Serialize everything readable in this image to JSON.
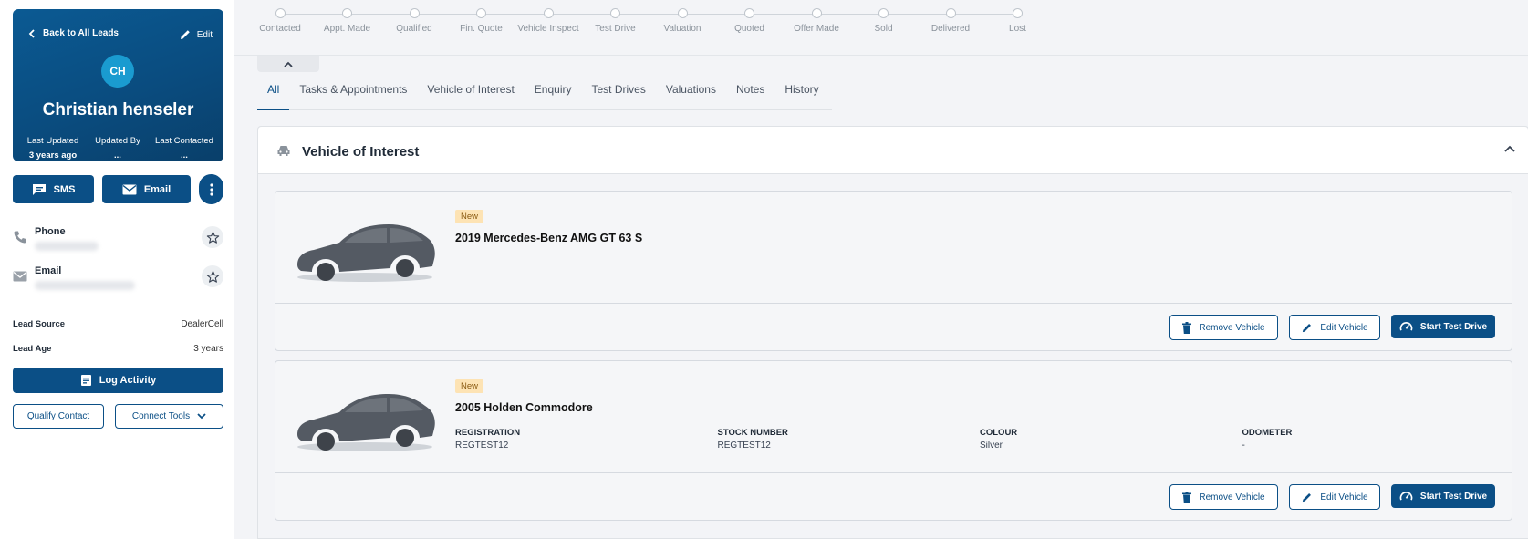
{
  "lead": {
    "back_label": "Back to All Leads",
    "edit_label": "Edit",
    "initials": "CH",
    "name": "Christian henseler",
    "meta": [
      {
        "label": "Last Updated",
        "value": "3 years ago"
      },
      {
        "label": "Updated By",
        "value": "..."
      },
      {
        "label": "Last Contacted",
        "value": "..."
      }
    ]
  },
  "actions": {
    "sms_label": "SMS",
    "email_label": "Email"
  },
  "contacts": {
    "phone_label": "Phone",
    "email_label": "Email"
  },
  "details": {
    "lead_source_label": "Lead Source",
    "lead_source_value": "DealerCell",
    "lead_age_label": "Lead Age",
    "lead_age_value": "3 years"
  },
  "buttons": {
    "log_activity": "Log Activity",
    "qualify_contact": "Qualify Contact",
    "connect_tools": "Connect Tools"
  },
  "pipeline": {
    "stages": [
      "Contacted",
      "Appt. Made",
      "Qualified",
      "Fin. Quote",
      "Vehicle Inspect",
      "Test Drive",
      "Valuation",
      "Quoted",
      "Offer Made",
      "Sold",
      "Delivered",
      "Lost"
    ]
  },
  "tabs": [
    "All",
    "Tasks & Appointments",
    "Vehicle of Interest",
    "Enquiry",
    "Test Drives",
    "Valuations",
    "Notes",
    "History"
  ],
  "panel": {
    "title": "Vehicle of Interest"
  },
  "vehicles": [
    {
      "badge": "New",
      "title": "2019 Mercedes-Benz AMG GT 63 S",
      "specs": []
    },
    {
      "badge": "New",
      "title": "2005 Holden Commodore",
      "specs": [
        {
          "label": "REGISTRATION",
          "value": "REGTEST12"
        },
        {
          "label": "STOCK NUMBER",
          "value": "REGTEST12"
        },
        {
          "label": "COLOUR",
          "value": "Silver"
        },
        {
          "label": "ODOMETER",
          "value": "-"
        }
      ]
    }
  ],
  "vehicle_buttons": {
    "remove": "Remove Vehicle",
    "edit": "Edit Vehicle",
    "test_drive": "Start Test Drive"
  },
  "colors": {
    "primary": "#0b4f86",
    "badge_bg": "#fde3b4"
  }
}
